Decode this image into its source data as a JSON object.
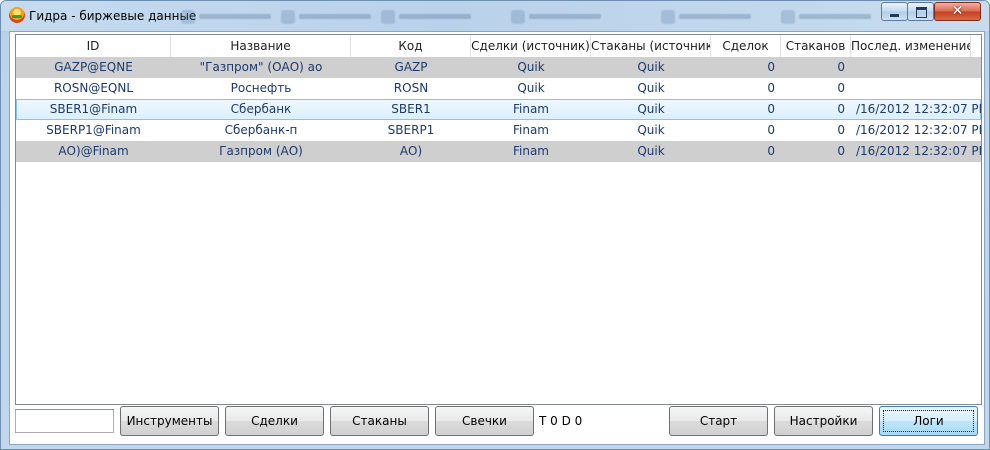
{
  "window": {
    "title": "Гидра - биржевые данные",
    "icons": {
      "app": "hydra-app-icon",
      "minimize": "minimize-icon",
      "maximize": "maximize-icon",
      "close": "close-icon"
    },
    "close_glyph": "✕"
  },
  "grid": {
    "columns": [
      "ID",
      "Название",
      "Код",
      "Сделки (источник)",
      "Стаканы (источник)",
      "Сделок",
      "Стаканов",
      "Послед. изменение"
    ],
    "rows": [
      {
        "id": "GAZP@EQNE",
        "name": "\"Газпром\" (ОАО) ао",
        "code": "GAZP",
        "trades_source": "Quik",
        "depths_source": "Quik",
        "trades": "0",
        "depths": "0",
        "last_change": ""
      },
      {
        "id": "ROSN@EQNL",
        "name": "Роснефть",
        "code": "ROSN",
        "trades_source": "Quik",
        "depths_source": "Quik",
        "trades": "0",
        "depths": "0",
        "last_change": ""
      },
      {
        "id": "SBER1@Finam",
        "name": "Сбербанк",
        "code": "SBER1",
        "trades_source": "Finam",
        "depths_source": "Quik",
        "trades": "0",
        "depths": "0",
        "last_change": "/16/2012 12:32:07 PM"
      },
      {
        "id": "SBERP1@Finam",
        "name": "Сбербанк-п",
        "code": "SBERP1",
        "trades_source": "Finam",
        "depths_source": "Quik",
        "trades": "0",
        "depths": "0",
        "last_change": "/16/2012 12:32:07 PM"
      },
      {
        "id": "АО)@Finam",
        "name": "Газпром (АО)",
        "code": "АО)",
        "trades_source": "Finam",
        "depths_source": "Quik",
        "trades": "0",
        "depths": "0",
        "last_change": "/16/2012 12:32:07 PM"
      }
    ],
    "selected_row": 2
  },
  "toolbar": {
    "filter_value": "",
    "instruments_label": "Инструменты",
    "trades_label": "Сделки",
    "depths_label": "Стаканы",
    "candles_label": "Свечки",
    "counter_text": "T 0 D 0",
    "start_label": "Старт",
    "settings_label": "Настройки",
    "logs_label": "Логи"
  },
  "colors": {
    "cell_text": "#1c3a6e",
    "alt_row": "#cfcfcf",
    "selection": "#dbefff"
  }
}
